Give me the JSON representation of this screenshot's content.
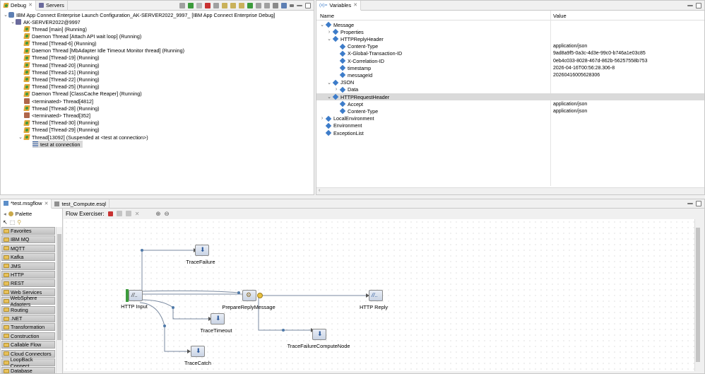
{
  "debug": {
    "tabs": [
      {
        "label": "Debug"
      },
      {
        "label": "Servers"
      }
    ],
    "launch": "IBM App Connect Enterprise Launch Configuration_AK-SERVER2022_9997_ [IBM App Connect Enterprise Debug]",
    "server": "AK-SERVER2022@9997",
    "threads": [
      {
        "label": "Thread [main] (Running)",
        "kind": "thread"
      },
      {
        "label": "Daemon Thread [Attach API wait loop] (Running)",
        "kind": "thread"
      },
      {
        "label": "Thread [Thread-6] (Running)",
        "kind": "thread"
      },
      {
        "label": "Daemon Thread [MbAdapter Idle Timeout Monitor thread] (Running)",
        "kind": "thread"
      },
      {
        "label": "Thread [Thread-19] (Running)",
        "kind": "thread"
      },
      {
        "label": "Thread [Thread-20] (Running)",
        "kind": "thread"
      },
      {
        "label": "Thread [Thread-21] (Running)",
        "kind": "thread"
      },
      {
        "label": "Thread [Thread-22] (Running)",
        "kind": "thread"
      },
      {
        "label": "Thread [Thread-25] (Running)",
        "kind": "thread"
      },
      {
        "label": "Daemon Thread [ClassCache Reaper] (Running)",
        "kind": "thread"
      },
      {
        "label": "<terminated> Thread[4812]",
        "kind": "term"
      },
      {
        "label": "Thread [Thread-28] (Running)",
        "kind": "thread"
      },
      {
        "label": "<terminated> Thread[352]",
        "kind": "term"
      },
      {
        "label": "Thread [Thread-30] (Running)",
        "kind": "thread"
      },
      {
        "label": "Thread [Thread-29] (Running)",
        "kind": "thread"
      },
      {
        "label": "Thread[13092] (Suspended at <test at connection>)",
        "kind": "thread"
      }
    ],
    "frame": "test at connection"
  },
  "variables": {
    "tab": "Variables",
    "tab_prefix": "(x)=",
    "col_name": "Name",
    "col_value": "Value",
    "rows": [
      {
        "name": "Message",
        "value": "",
        "level": 0,
        "tw": "v"
      },
      {
        "name": "Properties",
        "value": "",
        "level": 1,
        "tw": ">"
      },
      {
        "name": "HTTPReplyHeader",
        "value": "",
        "level": 1,
        "tw": "v"
      },
      {
        "name": "Content-Type",
        "value": "application/json",
        "level": 2,
        "tw": ""
      },
      {
        "name": "X-Global-Transaction-ID",
        "value": "9ad8a9f5-0a3c-4d3e-99c0-b746a1e03c85",
        "level": 2,
        "tw": ""
      },
      {
        "name": "X-Correlation-ID",
        "value": "0eb4c033-8028-467d-862b-56257558b753",
        "level": 2,
        "tw": ""
      },
      {
        "name": "timestamp",
        "value": "2026-04-16T00:56:28.306-8",
        "level": 2,
        "tw": ""
      },
      {
        "name": "messageId",
        "value": "20260416005628306",
        "level": 2,
        "tw": ""
      },
      {
        "name": "JSON",
        "value": "",
        "level": 1,
        "tw": "v"
      },
      {
        "name": "Data",
        "value": "",
        "level": 2,
        "tw": ">"
      },
      {
        "name": "HTTPRequestHeader",
        "value": "",
        "level": 1,
        "tw": "v",
        "selected": true
      },
      {
        "name": "Accept",
        "value": "application/json",
        "level": 2,
        "tw": ""
      },
      {
        "name": "Content-Type",
        "value": "application/json",
        "level": 2,
        "tw": ""
      },
      {
        "name": "LocalEnvironment",
        "value": "",
        "level": 0,
        "tw": ">"
      },
      {
        "name": "Environment",
        "value": "",
        "level": 0,
        "tw": ""
      },
      {
        "name": "ExceptionList",
        "value": "",
        "level": 0,
        "tw": ""
      }
    ]
  },
  "editor": {
    "tabs": [
      {
        "label": "*test.msgflow",
        "active": true
      },
      {
        "label": "test_Compute.esql",
        "active": false
      }
    ],
    "title": "Flow Exerciser:",
    "palette_title": "Palette",
    "palette": [
      "Favorites",
      "IBM MQ",
      "MQTT",
      "Kafka",
      "JMS",
      "HTTP",
      "REST",
      "Web Services",
      "WebSphere Adapters",
      "Routing",
      ".NET",
      "Transformation",
      "Construction",
      "Callable Flow",
      "Cloud Connectors",
      "LoopBack Connect...",
      "Database"
    ],
    "nodes": [
      {
        "id": "http-input",
        "label": "HTTP Input"
      },
      {
        "id": "trace-failure",
        "label": "TraceFailure"
      },
      {
        "id": "prepare-reply",
        "label": "PrepareReplyMessage"
      },
      {
        "id": "http-reply",
        "label": "HTTP Reply"
      },
      {
        "id": "trace-timeout",
        "label": "TraceTimeout"
      },
      {
        "id": "trace-catch",
        "label": "TraceCatch"
      },
      {
        "id": "trace-failure-compute",
        "label": "TraceFailureComputeNode"
      }
    ]
  },
  "colors": {
    "accent": "#3d7cc9",
    "selection": "#dadada"
  }
}
